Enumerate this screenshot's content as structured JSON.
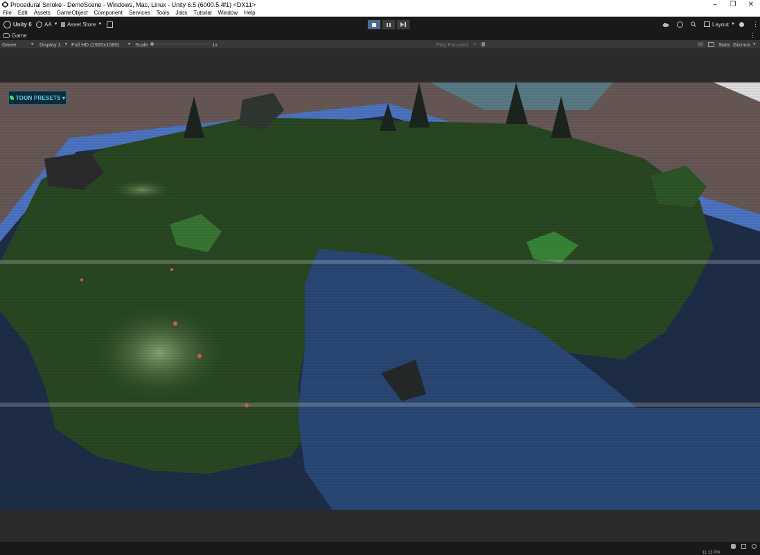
{
  "window": {
    "title": "Procedural Smoke - DemoScene - Windows, Mac, Linux - Unity 6.5 (6000.5.4f1) <DX11>",
    "controls": {
      "minimize": "–",
      "restore": "❐",
      "close": "✕"
    }
  },
  "menu": [
    "File",
    "Edit",
    "Assets",
    "GameObject",
    "Component",
    "Services",
    "Tools",
    "Jobs",
    "Tutorial",
    "Window",
    "Help"
  ],
  "toolbar": {
    "unity_label": "Unity 6",
    "account_label": "AA",
    "asset_store_label": "Asset Store",
    "layout_label": "Layout"
  },
  "tab": {
    "label": "Game"
  },
  "game_toolbar": {
    "view_select": "Game",
    "display_select": "Display 1",
    "resolution_select": "Full HD (1920x1080)",
    "scale_label": "Scale",
    "scale_value": "1x",
    "scale_fraction": 0.0,
    "play_focused": "Play Focused",
    "stats_label": "Stats",
    "gizmos_label": "Gizmos"
  },
  "overlay": {
    "toon_presets_label": "TOON PRESETS ▾"
  },
  "status": {
    "clock": "11:13 PM"
  },
  "colors": {
    "accent_play": "#4a6a92",
    "toon_text": "#5ad3e3",
    "toon_border": "#1b6f86",
    "grass": "#2a4a24",
    "water": "#2b4b7a",
    "water_border": "#4f79c9",
    "sky": "#6b5b5a"
  },
  "icons": [
    "unity-logo-icon",
    "account-icon",
    "asset-store-icon",
    "package-icon",
    "stop-icon",
    "pause-icon",
    "step-icon",
    "cloud-icon",
    "history-icon",
    "search-icon",
    "layout-icon",
    "help-icon",
    "more-icon",
    "game-icon",
    "mute-icon",
    "aspect-icon",
    "bug-icon",
    "console-icon",
    "notification-icon"
  ]
}
